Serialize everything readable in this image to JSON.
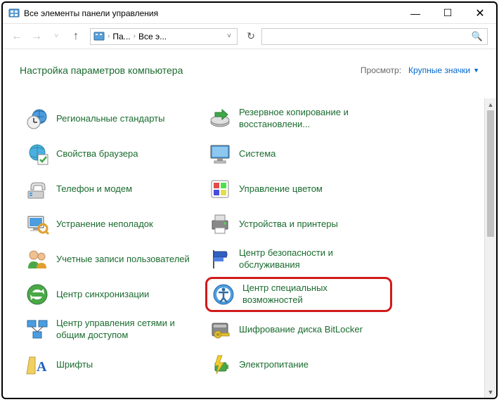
{
  "window": {
    "title": "Все элементы панели управления"
  },
  "nav": {
    "crumb1": "Па...",
    "crumb2": "Все э...",
    "search_placeholder": ""
  },
  "header": {
    "title": "Настройка параметров компьютера",
    "view_label": "Просмотр:",
    "view_value": "Крупные значки"
  },
  "items": {
    "r0c0": "Региональные стандарты",
    "r0c1": "Резервное копирование и восстановлени...",
    "r1c0": "Свойства браузера",
    "r1c1": "Система",
    "r2c0": "Телефон и модем",
    "r2c1": "Управление цветом",
    "r3c0": "Устранение неполадок",
    "r3c1": "Устройства и принтеры",
    "r4c0": "Учетные записи пользователей",
    "r4c1": "Центр безопасности и обслуживания",
    "r5c0": "Центр синхронизации",
    "r5c1": "Центр специальных возможностей",
    "r6c0": "Центр управления сетями и общим доступом",
    "r6c1": "Шифрование диска BitLocker",
    "r7c0": "Шрифты",
    "r7c1": "Электропитание"
  }
}
